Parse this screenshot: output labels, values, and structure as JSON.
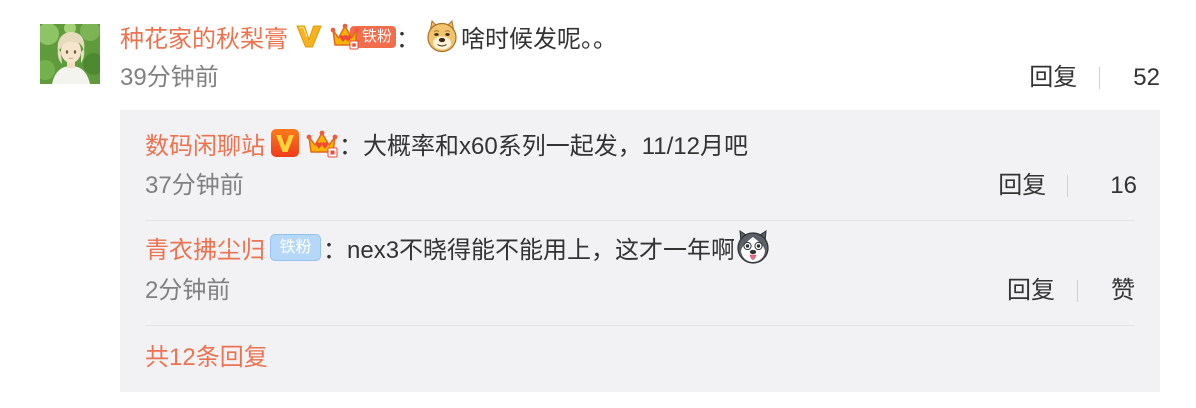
{
  "colors": {
    "accent": "#eb7350",
    "text": "#333333",
    "muted": "#808080",
    "panel": "#f2f2f5"
  },
  "comment": {
    "avatar_icon": "user-avatar",
    "username": "种花家的秋梨膏",
    "badges": [
      {
        "icon": "vip-v-gold-icon"
      },
      {
        "icon": "crown-icon",
        "label": "铁粉"
      }
    ],
    "colon": "：",
    "emoji": "doge-emoji-icon",
    "text": "啥时候发呢。。",
    "time": "39分钟前",
    "reply_label": "回复",
    "like_icon": "thumbs-up-icon",
    "like_count": "52"
  },
  "replies": [
    {
      "username": "数码闲聊站",
      "badges": [
        {
          "icon": "vip-v-red-icon"
        },
        {
          "icon": "crown-icon"
        }
      ],
      "colon": "：",
      "text": "大概率和x60系列一起发，11/12月吧",
      "time": "37分钟前",
      "reply_label": "回复",
      "like_icon": "thumbs-up-icon",
      "like_count": "16"
    },
    {
      "username": "青衣拂尘归",
      "badges": [
        {
          "icon": "fan-badge",
          "label": "铁粉"
        }
      ],
      "colon": "：",
      "text": "nex3不晓得能不能用上，这才一年啊",
      "emoji": "husky-emoji-icon",
      "time": "2分钟前",
      "reply_label": "回复",
      "like_icon": "thumbs-up-icon",
      "like_label": "赞"
    }
  ],
  "more_replies": "共12条回复"
}
